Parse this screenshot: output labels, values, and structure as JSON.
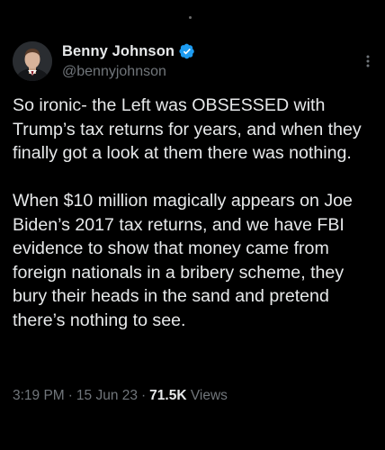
{
  "author": {
    "display_name": "Benny Johnson",
    "handle": "@bennyjohnson",
    "verified": true,
    "avatar_icon": "avatar-photo"
  },
  "tweet": {
    "paragraphs": [
      "So ironic- the Left was OBSESSED with Trump’s tax returns for years, and when they finally got a look at them there was nothing.",
      "When $10 million magically appears on Joe Biden’s 2017 tax returns, and we have FBI evidence to show that money came from foreign nationals in a bribery scheme, they bury their heads in the sand and pretend there’s nothing to see."
    ]
  },
  "meta": {
    "time": "3:19 PM",
    "date": "15 Jun 23",
    "separator": "·",
    "views_count": "71.5K",
    "views_label": "Views"
  },
  "colors": {
    "background": "#000000",
    "text_primary": "#e7e9ea",
    "text_secondary": "#71767b",
    "verified_badge": "#1d9bf0"
  },
  "icons": {
    "verified": "verified-badge-icon",
    "more": "more-vertical-icon"
  }
}
